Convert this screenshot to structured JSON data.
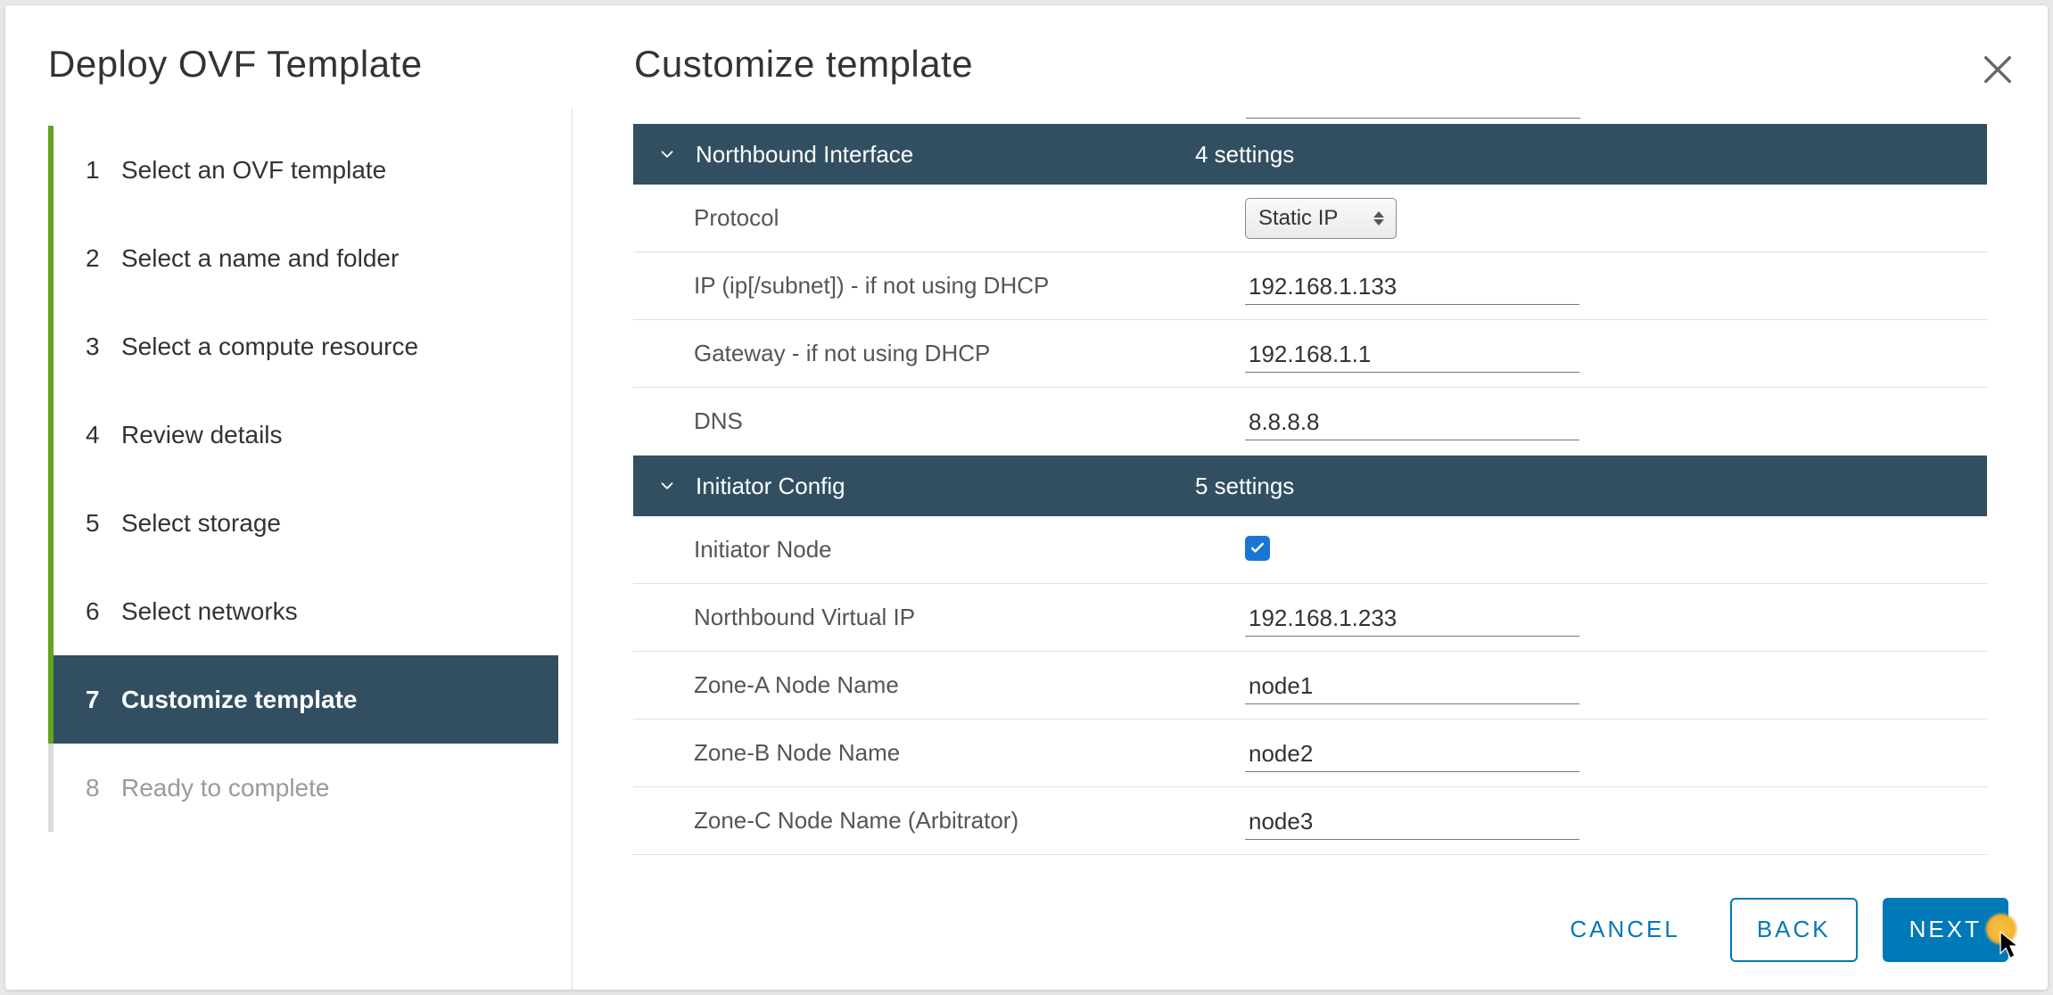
{
  "wizard_title": "Deploy OVF Template",
  "page_title": "Customize template",
  "steps": [
    {
      "num": "1",
      "label": "Select an OVF template",
      "state": "completed"
    },
    {
      "num": "2",
      "label": "Select a name and folder",
      "state": "completed"
    },
    {
      "num": "3",
      "label": "Select a compute resource",
      "state": "completed"
    },
    {
      "num": "4",
      "label": "Review details",
      "state": "completed"
    },
    {
      "num": "5",
      "label": "Select storage",
      "state": "completed"
    },
    {
      "num": "6",
      "label": "Select networks",
      "state": "completed"
    },
    {
      "num": "7",
      "label": "Customize template",
      "state": "active"
    },
    {
      "num": "8",
      "label": "Ready to complete",
      "state": "disabled"
    }
  ],
  "sections": {
    "northbound": {
      "title": "Northbound Interface",
      "subtitle": "4 settings",
      "rows": {
        "protocol": {
          "label": "Protocol",
          "value": "Static IP"
        },
        "ip": {
          "label": "IP (ip[/subnet]) - if not using DHCP",
          "value": "192.168.1.133"
        },
        "gateway": {
          "label": "Gateway - if not using DHCP",
          "value": "192.168.1.1"
        },
        "dns": {
          "label": "DNS",
          "value": "8.8.8.8"
        }
      }
    },
    "initiator": {
      "title": "Initiator Config",
      "subtitle": "5 settings",
      "rows": {
        "node": {
          "label": "Initiator Node",
          "checked": true
        },
        "vip": {
          "label": "Northbound Virtual IP",
          "value": "192.168.1.233"
        },
        "zonea": {
          "label": "Zone-A Node Name",
          "value": "node1"
        },
        "zoneb": {
          "label": "Zone-B Node Name",
          "value": "node2"
        },
        "zonec": {
          "label": "Zone-C Node Name (Arbitrator)",
          "value": "node3"
        }
      }
    }
  },
  "footer": {
    "cancel": "CANCEL",
    "back": "BACK",
    "next": "NEXT"
  }
}
